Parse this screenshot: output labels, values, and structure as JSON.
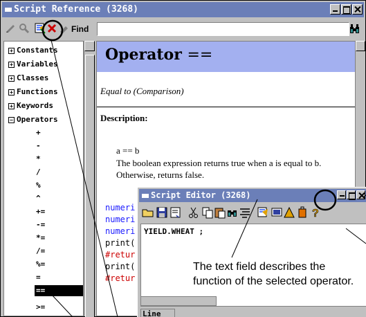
{
  "main_window": {
    "title": "Script Reference (3268)",
    "find_label": "Find",
    "find_value": ""
  },
  "tree": {
    "categories": [
      "Constants",
      "Variables",
      "Classes",
      "Functions",
      "Keywords",
      "Operators"
    ],
    "operators": [
      "+",
      "-",
      "*",
      "/",
      "%",
      "^",
      "+=",
      "-=",
      "*=",
      "/=",
      "%=",
      "=",
      "==",
      ">="
    ],
    "selected_operator": "=="
  },
  "doc": {
    "title_word": "Operator",
    "title_symbol": "==",
    "subtitle": "Equal to (Comparison)",
    "description_heading": "Description:",
    "syntax": "a == b",
    "description": "The boolean expression returns true when a is equal to b. Otherwise, returns false.",
    "code_lines": [
      {
        "text": "numeri",
        "color": "#1a1aff"
      },
      {
        "text": "numeri",
        "color": "#1a1aff"
      },
      {
        "text": "numeri",
        "color": "#1a1aff"
      },
      {
        "text": "print(",
        "color": "#000000"
      },
      {
        "text": "#retur",
        "color": "#cc0000"
      },
      {
        "text": "print(",
        "color": "#000000"
      },
      {
        "text": "#retur",
        "color": "#cc0000"
      }
    ]
  },
  "editor": {
    "title": "Script Editor (3268)",
    "code": "YIELD.WHEAT ;",
    "status_label": "Line"
  },
  "callout": {
    "text": "The text field describes the function of the selected operator."
  },
  "colors": {
    "titlebar": "#6b7fb8",
    "doc_header": "#a3b0f0",
    "window_bg": "#c0c0c0"
  },
  "icons": [
    "script-icon",
    "search-icon",
    "insert-icon",
    "clear-icon",
    "find-go-icon",
    "open-icon",
    "save-icon",
    "save-as-icon",
    "cut-icon",
    "copy-icon",
    "paste-icon",
    "find-icon",
    "format-icon",
    "run-icon",
    "script-ref-icon",
    "help-icon"
  ]
}
